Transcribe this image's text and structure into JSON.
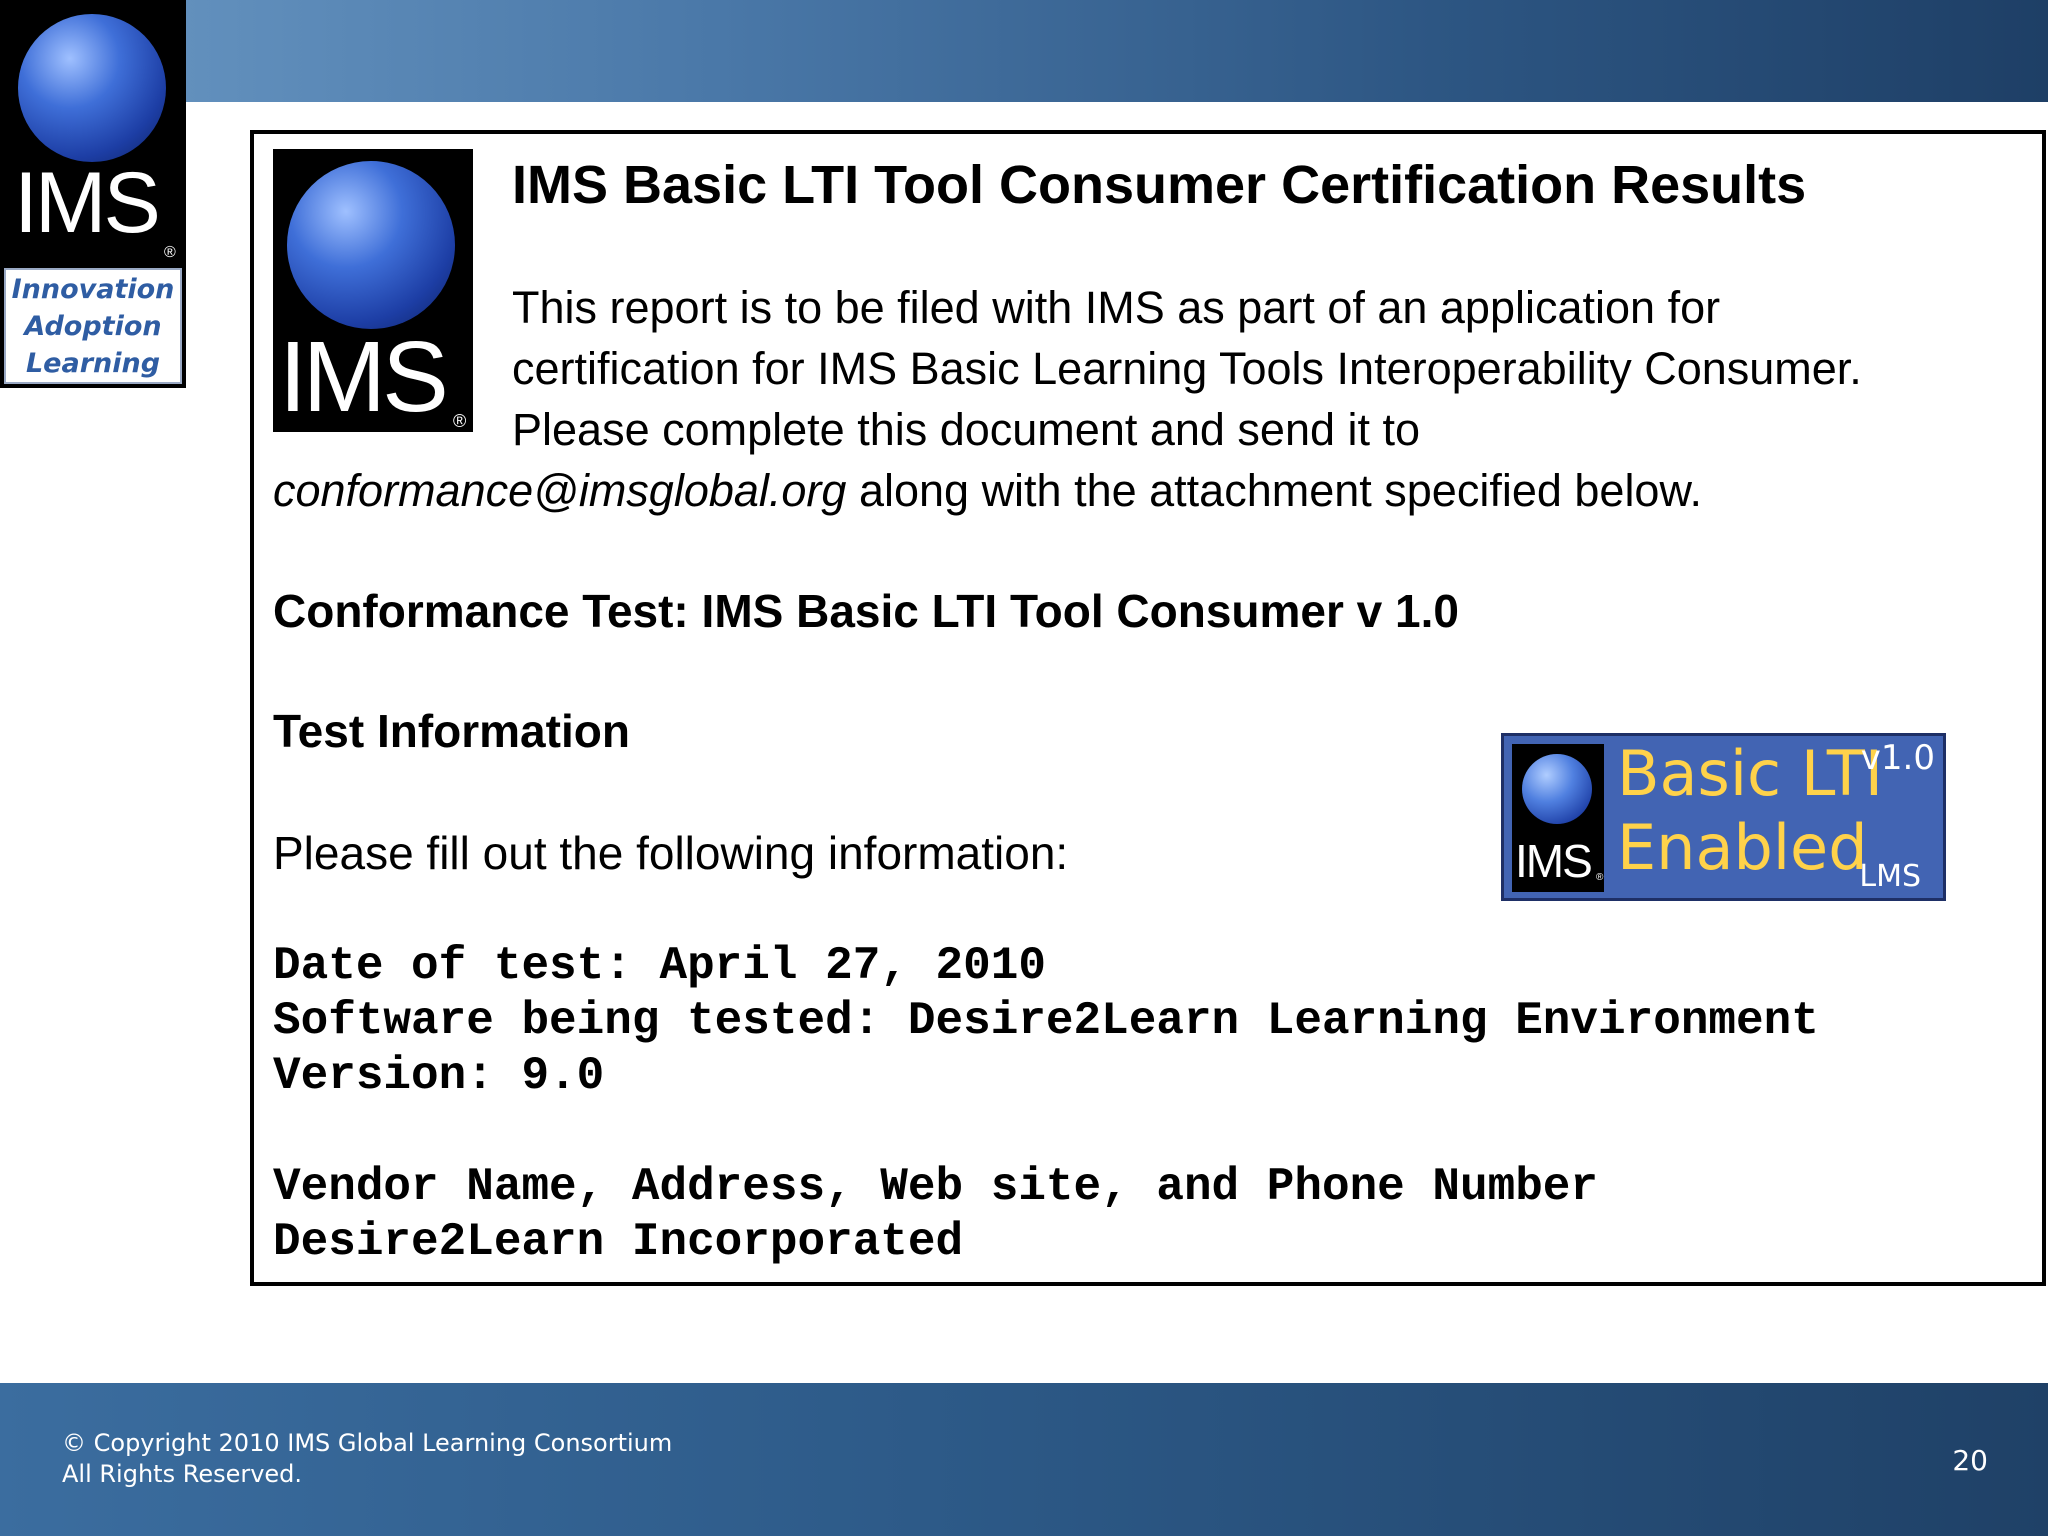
{
  "corner_logo": {
    "wordmark": "IMS",
    "registered": "®",
    "tagline": [
      "Innovation",
      "Adoption",
      "Learning"
    ]
  },
  "document": {
    "logo": {
      "wordmark": "IMS",
      "registered": "®"
    },
    "title": "IMS Basic LTI Tool Consumer Certification Results",
    "intro": {
      "line1": "This report is to be filed with IMS as part of an application for",
      "line2": "certification for IMS Basic Learning Tools Interoperability Consumer.",
      "line3": "Please complete this document and send it to",
      "email": "conformance@imsglobal.org",
      "line4_rest": " along with the attachment specified below."
    },
    "conformance_test": "Conformance Test:  IMS Basic LTI Tool Consumer v 1.0",
    "test_info_heading": "Test Information",
    "fill_prompt": "Please fill out the following information:",
    "fields": {
      "date": "Date of test: April 27, 2010",
      "software": "Software being tested: Desire2Learn Learning Environment",
      "version": "Version: 9.0",
      "vendor_label": "Vendor Name, Address, Web site, and Phone Number",
      "vendor_value": "Desire2Learn Incorporated"
    }
  },
  "badge": {
    "ims": "IMS",
    "registered": "®",
    "line1": "Basic LTI",
    "line2": "Enabled",
    "version": "v1.0",
    "type": "LMS",
    "background_color": "#4264b3",
    "text_color": "#ffd24a"
  },
  "footer": {
    "copyright_line1": "© Copyright 2010 IMS Global Learning Consortium",
    "copyright_line2": "All Rights Reserved.",
    "page_number": "20"
  }
}
